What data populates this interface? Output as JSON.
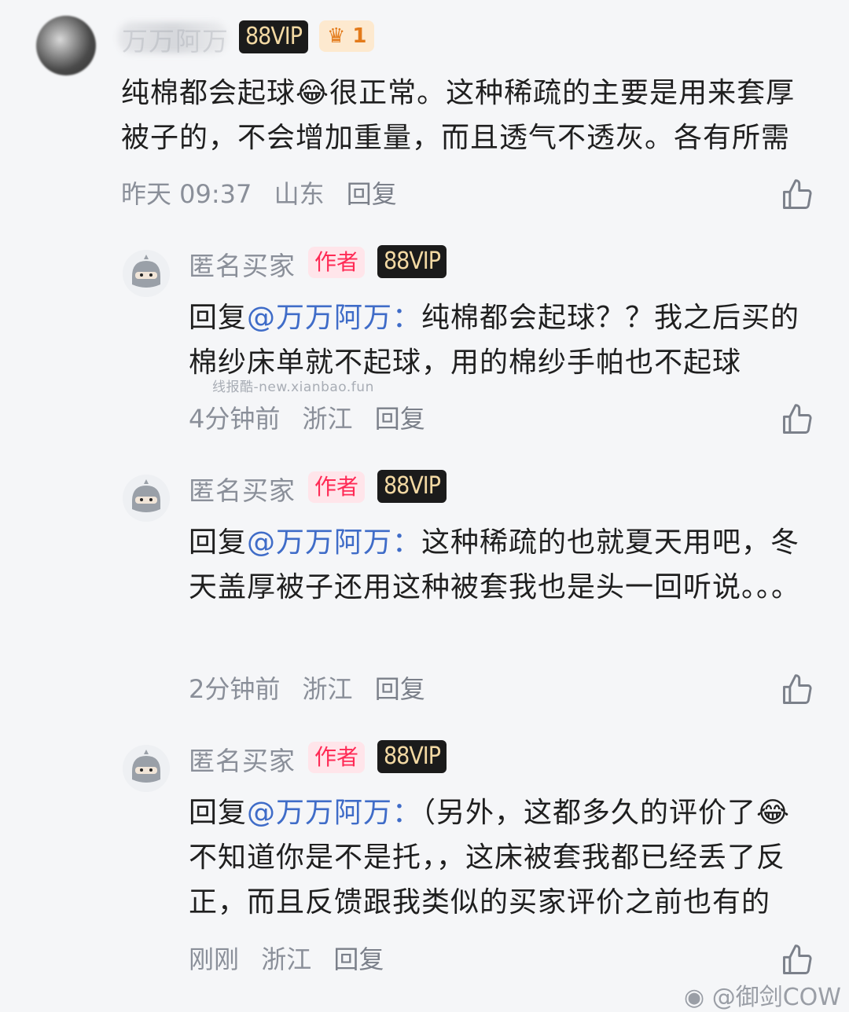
{
  "comments": [
    {
      "user": "万万阿万",
      "vip": "88VIP",
      "crown_count": "1",
      "text": "纯棉都会起球😂很正常。这种稀疏的主要是用来套厚被子的，不会增加重量，而且透气不透灰。各有所需",
      "time": "昨天 09:37",
      "location": "山东",
      "reply_label": "回复"
    },
    {
      "user": "匿名买家",
      "author_badge": "作者",
      "vip": "88VIP",
      "reply_prefix": "回复",
      "mention": "@万万阿万：",
      "text": "纯棉都会起球？？我之后买的棉纱床单就不起球，用的棉纱手帕也不起球",
      "time": "4分钟前",
      "location": "浙江",
      "reply_label": "回复"
    },
    {
      "user": "匿名买家",
      "author_badge": "作者",
      "vip": "88VIP",
      "reply_prefix": "回复",
      "mention": "@万万阿万：",
      "text": "这种稀疏的也就夏天用吧，冬天盖厚被子还用这种被套我也是头一回听说。。。",
      "time": "2分钟前",
      "location": "浙江",
      "reply_label": "回复"
    },
    {
      "user": "匿名买家",
      "author_badge": "作者",
      "vip": "88VIP",
      "reply_prefix": "回复",
      "mention": "@万万阿万：",
      "text": "（另外，这都多久的评价了😂不知道你是不是托，，这床被套我都已经丢了反正，而且反馈跟我类似的买家评价之前也有的",
      "time": "刚刚",
      "location": "浙江",
      "reply_label": "回复"
    }
  ],
  "watermark": "线报酷-new.xianbao.fun",
  "weibo_watermark": "@御剑COW",
  "colors": {
    "mention": "#3f6cc8",
    "author_badge": "#ff2a55",
    "vip_bg": "#1b1b1b"
  },
  "icons": {
    "like": "thumbs-up-icon",
    "avatar": "ninja-avatar-icon"
  }
}
